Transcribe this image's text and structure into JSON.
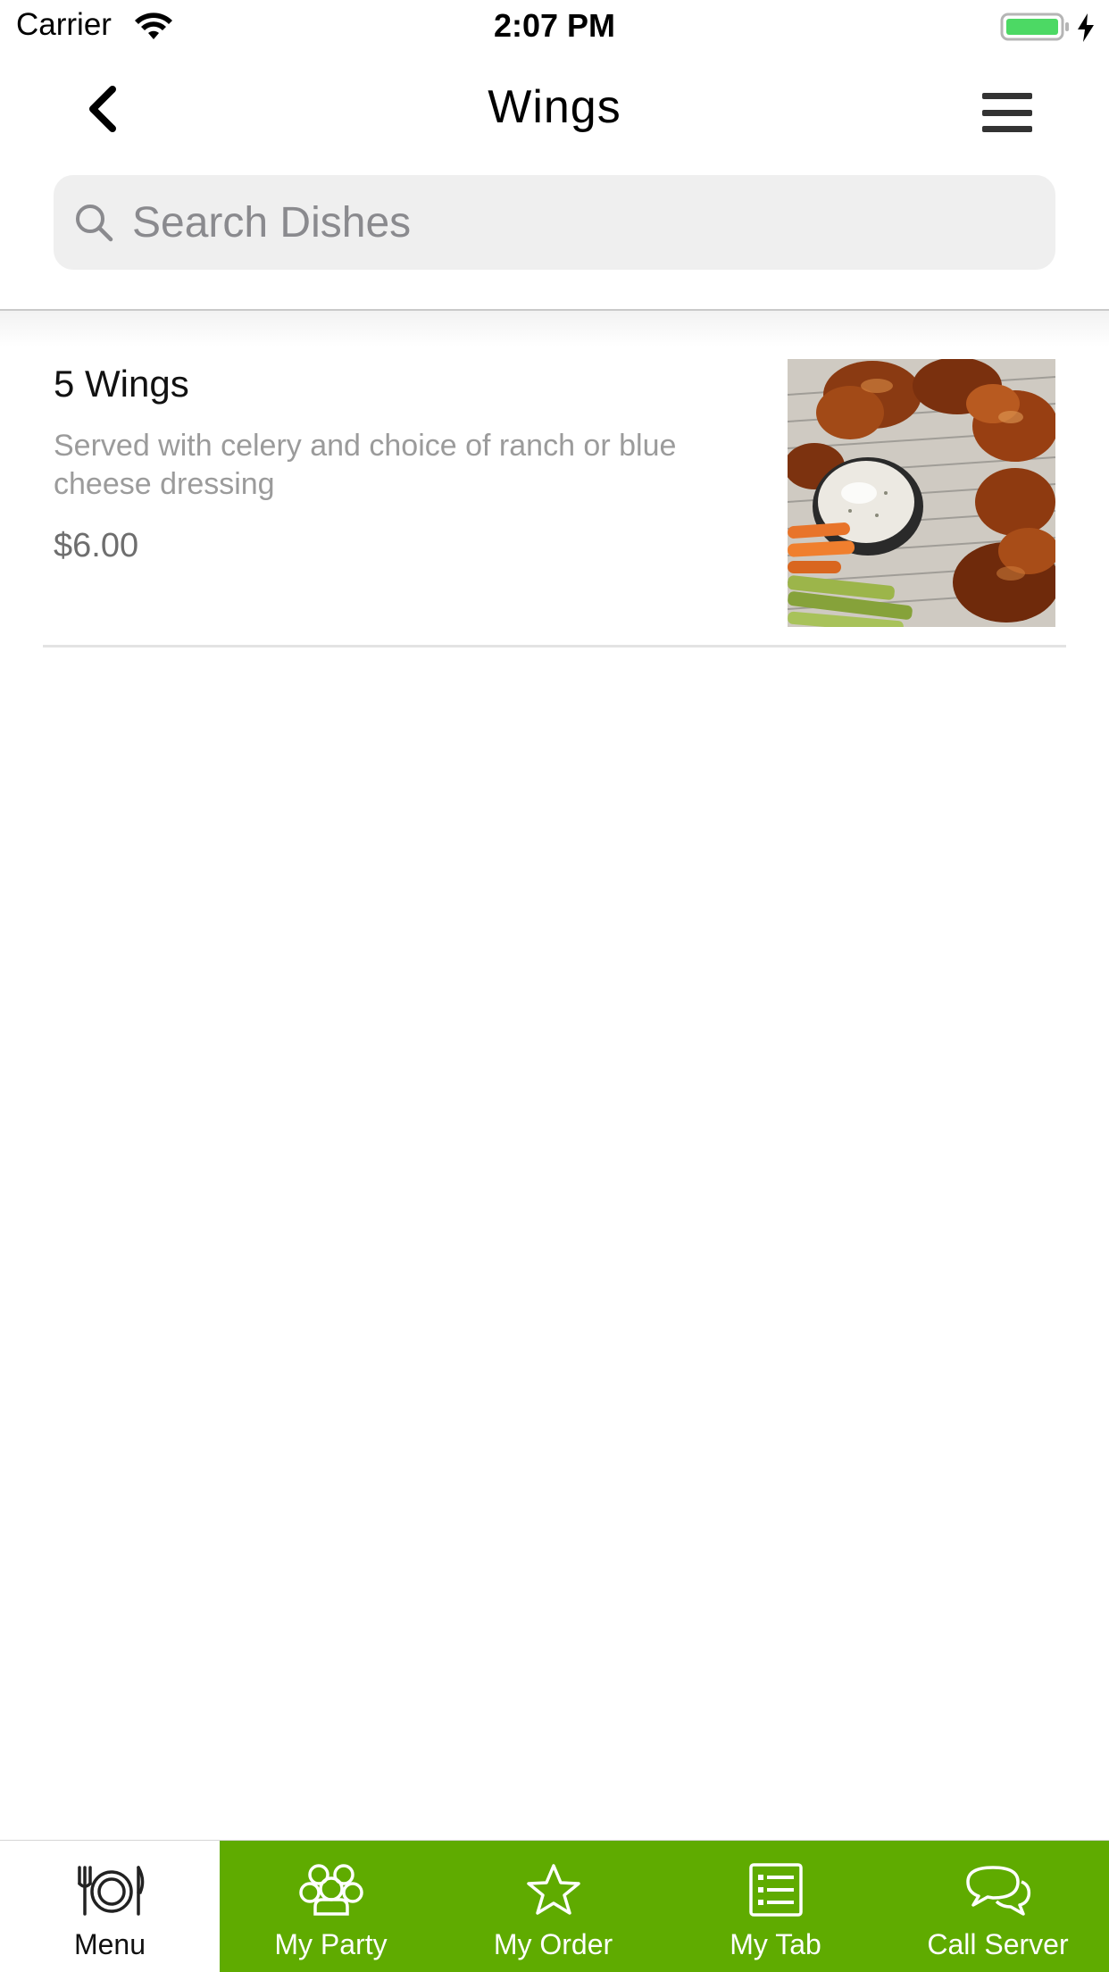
{
  "status_bar": {
    "carrier": "Carrier",
    "time": "2:07 PM",
    "battery_color": "#4cd964"
  },
  "nav": {
    "title": "Wings",
    "back_icon": "chevron-left-icon",
    "menu_icon": "hamburger-menu-icon"
  },
  "search": {
    "placeholder": "Search Dishes",
    "value": ""
  },
  "dishes": [
    {
      "name": "5 Wings",
      "description": "Served with celery and choice of ranch or blue cheese dressing",
      "price": "$6.00",
      "photo": "wings-photo"
    }
  ],
  "tabs": [
    {
      "label": "Menu",
      "icon": "plate-fork-knife-icon",
      "active": true
    },
    {
      "label": "My Party",
      "icon": "group-icon",
      "active": false
    },
    {
      "label": "My Order",
      "icon": "star-icon",
      "active": false
    },
    {
      "label": "My Tab",
      "icon": "list-icon",
      "active": false
    },
    {
      "label": "Call Server",
      "icon": "chat-bubbles-icon",
      "active": false
    }
  ],
  "colors": {
    "accent": "#5fab00",
    "search_bg": "#efefef",
    "description_text": "#9b9b9b",
    "price_text": "#6e6e6e"
  }
}
